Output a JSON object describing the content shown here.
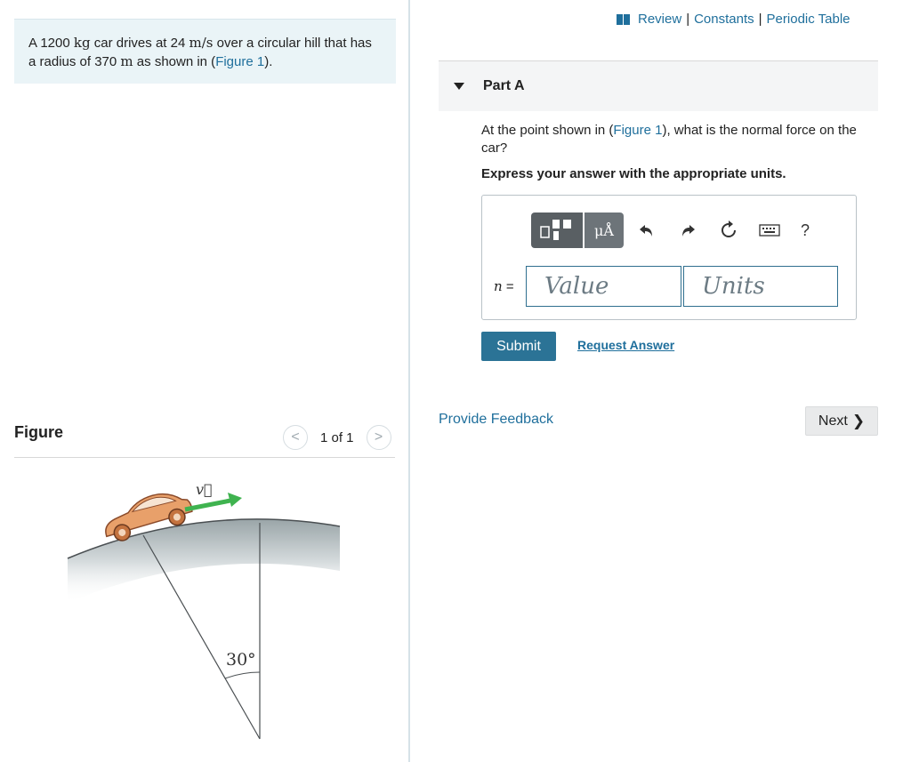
{
  "problem": {
    "t1": "A 1200 ",
    "mass_unit": "kg",
    "t2": " car drives at 24 ",
    "speed_unit": "m/s",
    "t3": " over a circular hill that has a radius of 370 ",
    "radius_unit": "m",
    "t4": " as shown in (",
    "figure_link": "Figure 1",
    "t5": ")."
  },
  "figure_panel": {
    "title": "Figure",
    "prev_icon": "<",
    "next_icon": ">",
    "pager_text": "1 of 1",
    "velocity_label": "v⃗",
    "angle_label": "30°"
  },
  "header_links": {
    "review": "Review",
    "sep1": "|",
    "constants": "Constants",
    "sep2": "|",
    "periodic_table": "Periodic Table"
  },
  "part": {
    "label": "Part A",
    "q1": "At the point shown in (",
    "figure_link": "Figure 1",
    "q2": "), what is the normal force on the car?",
    "instruction": "Express your answer with the appropriate units."
  },
  "toolbar": {
    "units_button": "μÅ",
    "help": "?"
  },
  "answer": {
    "variable": "n",
    "equals": " =",
    "value_placeholder": "Value",
    "units_placeholder": "Units"
  },
  "actions": {
    "submit": "Submit",
    "request_answer": "Request Answer",
    "provide_feedback": "Provide Feedback",
    "next": "Next",
    "next_icon": "❯"
  },
  "colors": {
    "link": "#1f6f9c",
    "submit_bg": "#2b7396",
    "problem_bg": "#eaf4f7",
    "arrow": "#3fb34f"
  }
}
